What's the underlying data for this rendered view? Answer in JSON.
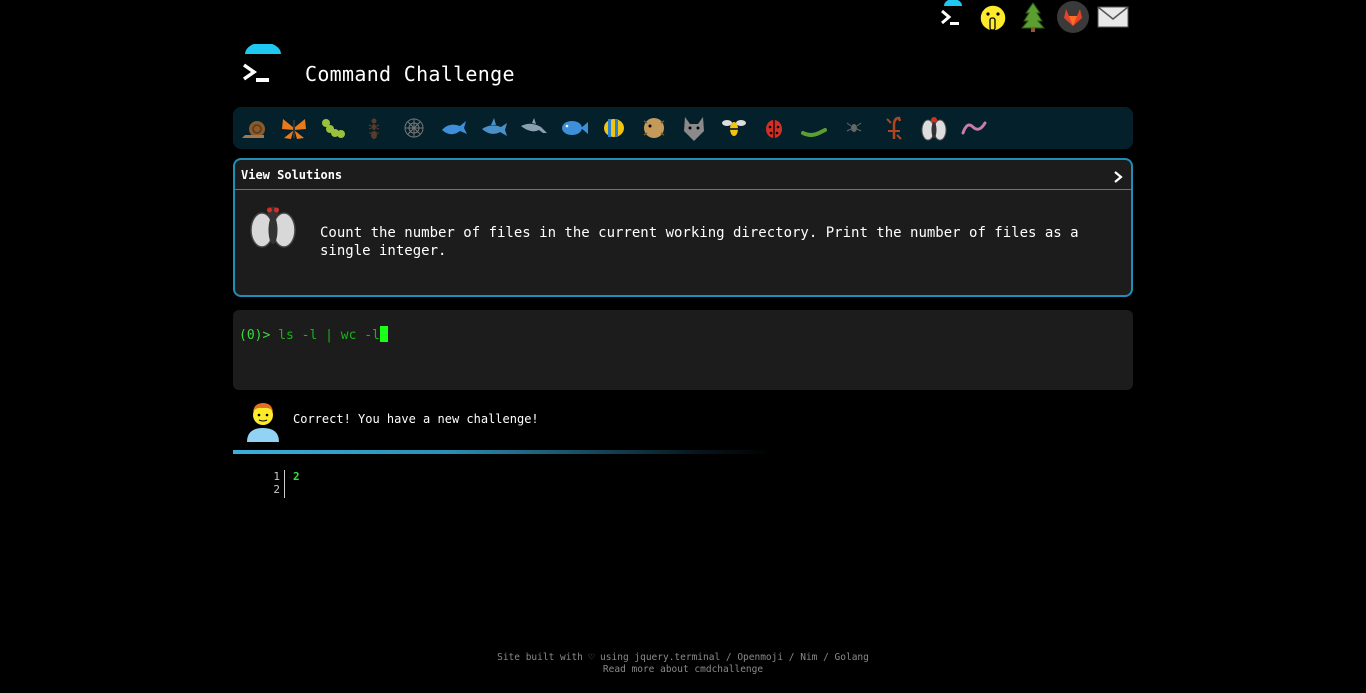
{
  "header": {
    "site_title": "Command Challenge"
  },
  "top_nav": {
    "icons": [
      "terminal-logo-icon",
      "shushing-face-icon",
      "evergreen-tree-icon",
      "gitlab-icon",
      "envelope-icon"
    ]
  },
  "challenge_bar": {
    "icons": [
      "snail-icon",
      "butterfly-icon",
      "caterpillar-icon",
      "ant-icon",
      "spider-web-icon",
      "whale-icon",
      "shark-icon",
      "dolphin-icon",
      "fish-icon",
      "tropical-fish-icon",
      "blowfish-icon",
      "wolf-icon",
      "honeybee-icon",
      "lady-beetle-icon",
      "worm-icon",
      "spider-icon",
      "scorpion-icon",
      "fly-icon",
      "earthworm-icon"
    ]
  },
  "challenge": {
    "view_solutions": "View Solutions",
    "description": "Count the number of files in the current working directory. Print the number of files as a single integer."
  },
  "terminal": {
    "prompt": "(0)> ",
    "command": "ls -l | wc -l"
  },
  "status": {
    "message": "Correct! You have a new challenge!"
  },
  "output": {
    "line_numbers": "1\n2",
    "text": "2"
  },
  "footer": {
    "line1": "Site built with ♡ using jquery.terminal / Openmoji / Nim / Golang",
    "line2": "Read more about cmdchallenge"
  },
  "colors": {
    "accent": "#1f8fb8",
    "terminal_green": "#3adb3a",
    "panel_bg": "#1c1c1c",
    "strip_bg": "#04202b"
  }
}
